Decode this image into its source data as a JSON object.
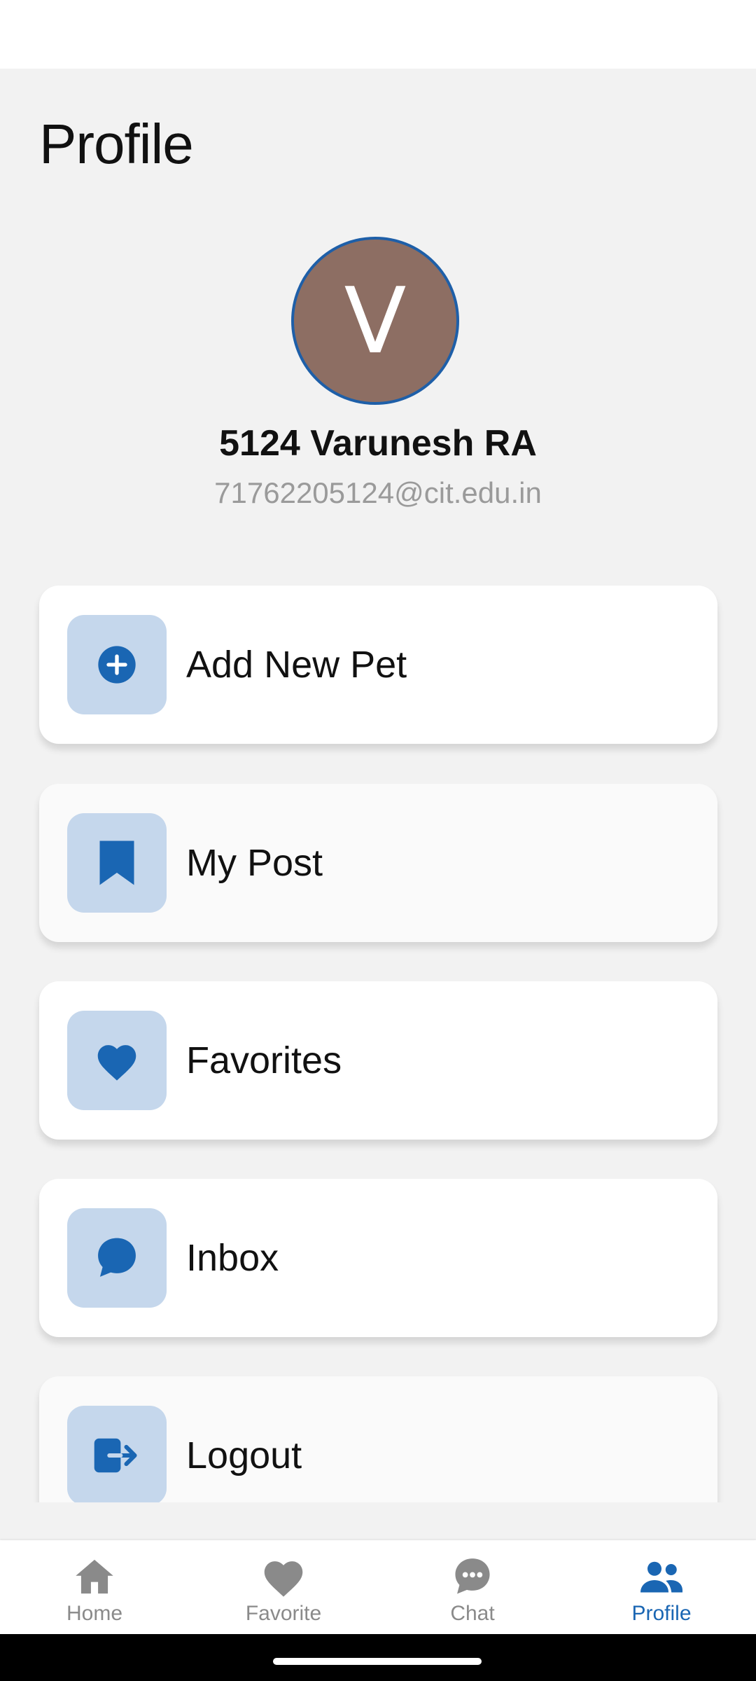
{
  "header": {
    "title": "Profile"
  },
  "profile": {
    "avatar_letter": "V",
    "name": "5124 Varunesh RA",
    "email": "71762205124@cit.edu.in"
  },
  "menu": [
    {
      "label": "Add New Pet",
      "icon": "add-circle-icon"
    },
    {
      "label": "My Post",
      "icon": "bookmark-icon"
    },
    {
      "label": "Favorites",
      "icon": "heart-icon"
    },
    {
      "label": "Inbox",
      "icon": "chat-bubble-icon"
    },
    {
      "label": "Logout",
      "icon": "logout-icon"
    }
  ],
  "bottom_nav": [
    {
      "label": "Home",
      "icon": "home-icon",
      "active": false
    },
    {
      "label": "Favorite",
      "icon": "heart-icon",
      "active": false
    },
    {
      "label": "Chat",
      "icon": "chat-icon",
      "active": false
    },
    {
      "label": "Profile",
      "icon": "people-icon",
      "active": true
    }
  ],
  "colors": {
    "accent": "#1a66b3",
    "icon_bg": "#c5d7ec",
    "avatar_bg": "#8d6e63",
    "inactive": "#8a8a8a",
    "screen_bg": "#f2f2f2"
  }
}
